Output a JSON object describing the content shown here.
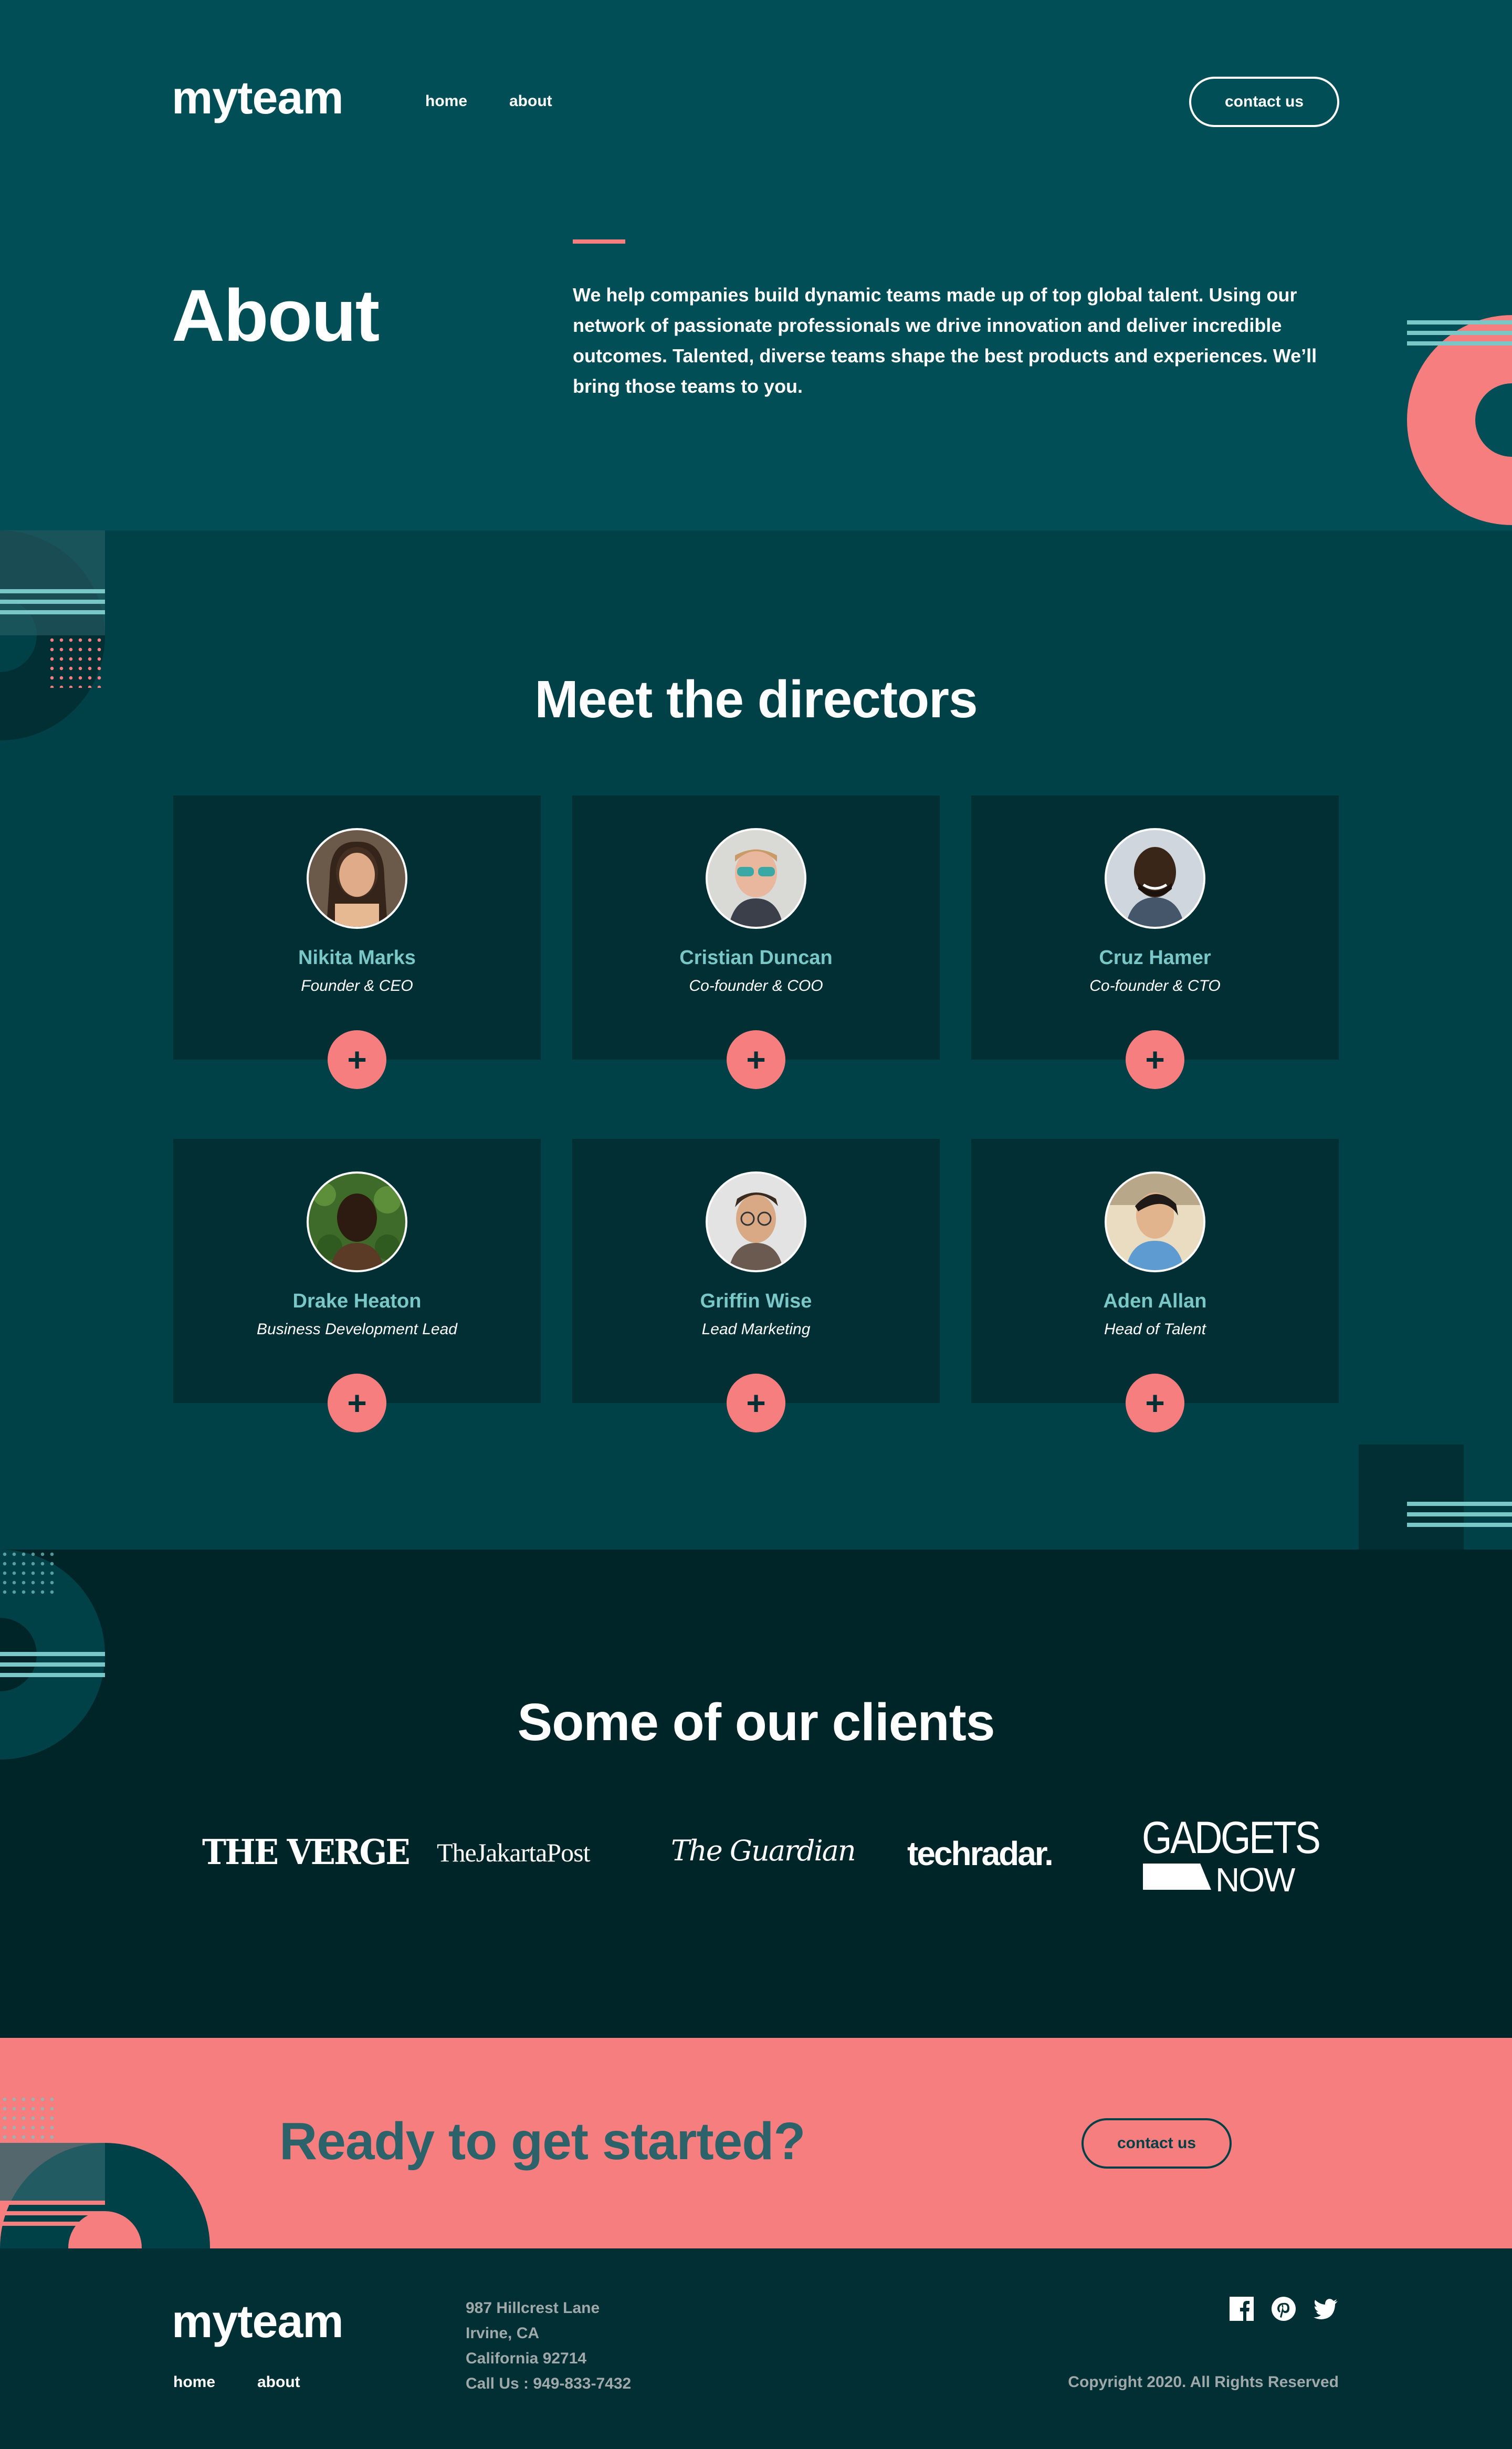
{
  "brand": {
    "name": "myteam"
  },
  "nav": {
    "home": "home",
    "about": "about",
    "contact": "contact us"
  },
  "hero": {
    "title": "About",
    "text": "We help companies build dynamic teams made up of top global talent. Using our network of passionate professionals we drive innovation and deliver incredible outcomes. Talented, diverse teams shape the best products and experiences. We’ll bring those teams to you."
  },
  "directors": {
    "title": "Meet the directors",
    "people": [
      {
        "name": "Nikita Marks",
        "role": "Founder & CEO"
      },
      {
        "name": "Cristian Duncan",
        "role": "Co-founder & COO"
      },
      {
        "name": "Cruz Hamer",
        "role": "Co-founder & CTO"
      },
      {
        "name": "Drake Heaton",
        "role": "Business Development Lead"
      },
      {
        "name": "Griffin Wise",
        "role": "Lead Marketing"
      },
      {
        "name": "Aden Allan",
        "role": "Head of Talent"
      }
    ],
    "expand_glyph": "+"
  },
  "clients": {
    "title": "Some of our clients",
    "logos": [
      "THE VERGE",
      "TheJakartaPost",
      "The Guardian",
      "techradar.",
      "GADGETS",
      "NOW"
    ]
  },
  "cta": {
    "title": "Ready to get started?",
    "button": "contact us"
  },
  "footer": {
    "address_lines": [
      "987 Hillcrest Lane",
      "Irvine, CA",
      "California 92714",
      "Call Us : 949-833-7432"
    ],
    "copyright": "Copyright 2020. All Rights Reserved",
    "social_icons": [
      "facebook-icon",
      "pinterest-icon",
      "twitter-icon"
    ]
  },
  "colors": {
    "accent": "#F67E7E",
    "mint": "#79C8C7",
    "dark_teal": "#004047",
    "darker_teal": "#012F34"
  }
}
